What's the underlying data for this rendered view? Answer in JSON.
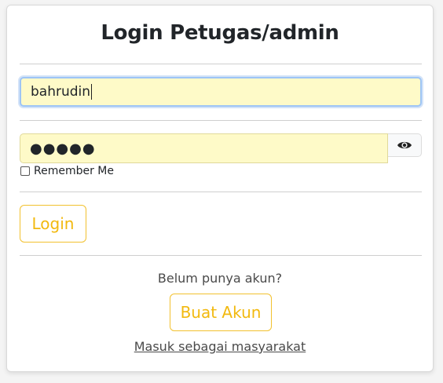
{
  "form": {
    "title": "Login Petugas/admin",
    "username": {
      "value": "bahrudin"
    },
    "password": {
      "value": "●●●●●"
    },
    "remember_label": "Remember Me",
    "login_label": "Login",
    "register_prompt": "Belum punya akun?",
    "register_label": "Buat Akun",
    "public_link_label": "Masuk sebagai masyarakat"
  },
  "colors": {
    "input_bg": "#fefac8",
    "accent": "#f2c12e",
    "focus_ring": "#9ec5f5"
  },
  "icons": {
    "password_toggle": "eye-icon"
  }
}
